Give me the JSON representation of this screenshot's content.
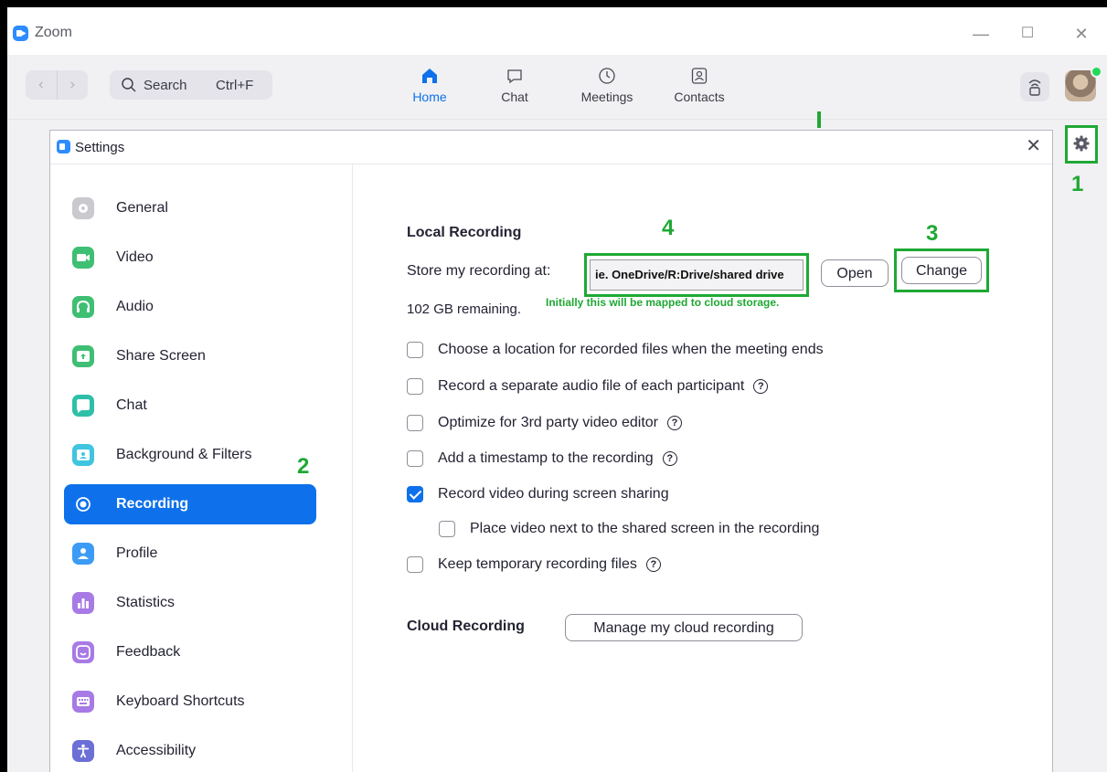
{
  "app": {
    "title": "Zoom"
  },
  "window_controls": {
    "minimize": "—",
    "maximize": "☐",
    "close": "✕"
  },
  "toolbar": {
    "back": "‹",
    "forward": "›",
    "search_label": "Search",
    "search_shortcut": "Ctrl+F",
    "tabs": [
      {
        "label": "Home",
        "icon": "home-icon",
        "active": true
      },
      {
        "label": "Chat",
        "icon": "chat-icon",
        "active": false
      },
      {
        "label": "Meetings",
        "icon": "clock-icon",
        "active": false
      },
      {
        "label": "Contacts",
        "icon": "contacts-icon",
        "active": false
      }
    ]
  },
  "annotations": {
    "one": "1",
    "two": "2",
    "three": "3",
    "four": "4"
  },
  "settings": {
    "title": "Settings",
    "close": "✕",
    "sidebar": [
      {
        "label": "General",
        "icon": "gear-icon",
        "color": "#c9c9cf"
      },
      {
        "label": "Video",
        "icon": "camera-icon",
        "color": "#3fbf73"
      },
      {
        "label": "Audio",
        "icon": "headphones-icon",
        "color": "#3fbf73"
      },
      {
        "label": "Share Screen",
        "icon": "share-screen-icon",
        "color": "#3fbf73"
      },
      {
        "label": "Chat",
        "icon": "chat-bubble-icon",
        "color": "#2fbfa8"
      },
      {
        "label": "Background & Filters",
        "icon": "background-icon",
        "color": "#3fc5e0"
      },
      {
        "label": "Recording",
        "icon": "record-icon",
        "color": "#ffffff",
        "active": true
      },
      {
        "label": "Profile",
        "icon": "profile-icon",
        "color": "#3c9cf5"
      },
      {
        "label": "Statistics",
        "icon": "statistics-icon",
        "color": "#a77ae6"
      },
      {
        "label": "Feedback",
        "icon": "feedback-icon",
        "color": "#a77ae6"
      },
      {
        "label": "Keyboard Shortcuts",
        "icon": "keyboard-icon",
        "color": "#a77ae6"
      },
      {
        "label": "Accessibility",
        "icon": "accessibility-icon",
        "color": "#6b6fd6"
      }
    ],
    "local_recording": {
      "heading": "Local Recording",
      "store_label": "Store my recording at:",
      "path_value": "ie. OneDrive/R:Drive/shared drive",
      "open_label": "Open",
      "change_label": "Change",
      "remaining": "102 GB remaining.",
      "mapped_note": "Initially this will be mapped to cloud storage."
    },
    "options": [
      {
        "label": "Choose a location for recorded files when the meeting ends",
        "checked": false,
        "help": false
      },
      {
        "label": "Record a separate audio file of each participant",
        "checked": false,
        "help": true
      },
      {
        "label": "Optimize for 3rd party video editor",
        "checked": false,
        "help": true
      },
      {
        "label": "Add a timestamp to the recording",
        "checked": false,
        "help": true
      },
      {
        "label": "Record video during screen sharing",
        "checked": true,
        "help": false
      },
      {
        "label": "Place video next to the shared screen in the recording",
        "checked": false,
        "help": false
      },
      {
        "label": "Keep temporary recording files",
        "checked": false,
        "help": true
      }
    ],
    "cloud_recording": {
      "heading": "Cloud Recording",
      "manage_label": "Manage my cloud recording"
    }
  },
  "colors": {
    "accent": "#0e71eb",
    "annotation": "#1fa834",
    "zoom_blue": "#2d8cff"
  }
}
